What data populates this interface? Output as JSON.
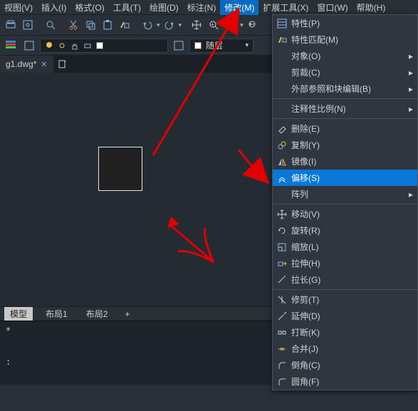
{
  "menubar": {
    "view": "视图(V)",
    "insert": "插入(I)",
    "format": "格式(O)",
    "tools": "工具(T)",
    "draw": "绘图(D)",
    "dimension": "标注(N)",
    "modify": "修改(M)",
    "express": "扩展工具(X)",
    "window": "窗口(W)",
    "help": "帮助(H)"
  },
  "layerbar": {
    "layer_label": "随层"
  },
  "file_tabs": {
    "active": "g1.dwg*",
    "close_glyph": "✕",
    "new_icon": "+"
  },
  "model_tabs": {
    "model": "模型",
    "layout1": "布局1",
    "layout2": "布局2",
    "plus": "+"
  },
  "cmd": {
    "prompt": "*",
    "colon": ":"
  },
  "dropdown": {
    "properties": "特性(P)",
    "match_props": "特性匹配(M)",
    "object": "对象(O)",
    "clip": "剪裁(C)",
    "xref_block": "外部参照和块编辑(B)",
    "anno_scale": "注释性比例(N)",
    "erase": "删除(E)",
    "copy": "复制(Y)",
    "mirror": "镜像(I)",
    "offset": "偏移(S)",
    "array": "阵列",
    "move": "移动(V)",
    "rotate": "旋转(R)",
    "scale": "缩放(L)",
    "stretch": "拉伸(H)",
    "lengthen": "拉长(G)",
    "trim": "修剪(T)",
    "extend": "延伸(D)",
    "break": "打断(K)",
    "join": "合并(J)",
    "chamfer": "倒角(C)",
    "fillet": "圆角(F)"
  },
  "icons": {
    "properties": "properties-icon",
    "match": "match-props-icon",
    "erase": "erase-icon",
    "copy": "copy-icon",
    "mirror": "mirror-icon",
    "offset": "offset-icon",
    "move": "move-icon",
    "rotate": "rotate-icon",
    "scale": "scale-icon",
    "stretch": "stretch-icon",
    "lengthen": "lengthen-icon",
    "trim": "trim-icon",
    "extend": "extend-icon",
    "break": "break-icon",
    "join": "join-icon",
    "chamfer": "chamfer-icon",
    "fillet": "fillet-icon"
  },
  "colors": {
    "highlight": "#0a78d6",
    "arrow": "#e00000"
  }
}
